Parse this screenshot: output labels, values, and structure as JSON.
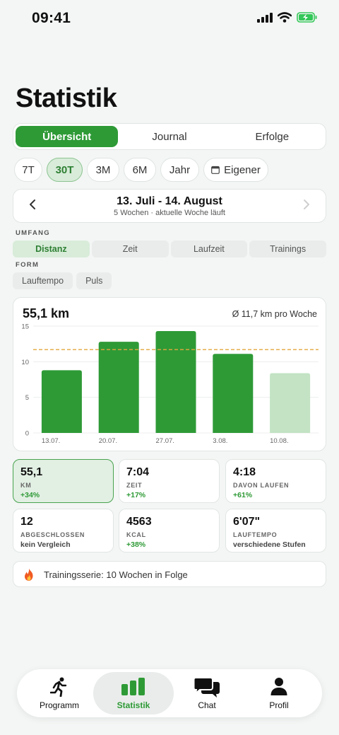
{
  "status_bar": {
    "time": "09:41"
  },
  "header": {
    "title": "Statistik"
  },
  "segments": [
    {
      "label": "Übersicht",
      "active": true
    },
    {
      "label": "Journal",
      "active": false
    },
    {
      "label": "Erfolge",
      "active": false
    }
  ],
  "ranges": [
    {
      "label": "7T",
      "active": false
    },
    {
      "label": "30T",
      "active": true
    },
    {
      "label": "3M",
      "active": false
    },
    {
      "label": "6M",
      "active": false
    },
    {
      "label": "Jahr",
      "active": false
    },
    {
      "label": "Eigener",
      "active": false,
      "icon": "calendar-icon"
    }
  ],
  "period": {
    "range": "13. Juli - 14. August",
    "subtitle": "5 Wochen · aktuelle Woche läuft"
  },
  "umfang": {
    "label": "UMFANG",
    "tabs": [
      "Distanz",
      "Zeit",
      "Laufzeit",
      "Trainings"
    ],
    "active": "Distanz"
  },
  "form": {
    "label": "FORM",
    "tabs": [
      "Lauftempo",
      "Puls"
    ]
  },
  "chart": {
    "total": "55,1 km",
    "average_label": "Ø 11,7 km pro Woche"
  },
  "chart_data": {
    "type": "bar",
    "categories": [
      "13.07.",
      "20.07.",
      "27.07.",
      "3.08.",
      "10.08."
    ],
    "values": [
      8.8,
      12.8,
      14.3,
      11.1,
      8.4
    ],
    "ylim": [
      0,
      15
    ],
    "yticks": [
      0,
      5,
      10,
      15
    ],
    "average": 11.7,
    "current_period_index": 4,
    "grid": true,
    "colors": {
      "bar": "#2e9a36",
      "current": "#c3e3c4",
      "average_line": "#e3a83c"
    }
  },
  "tiles": [
    {
      "value": "55,1",
      "label": "KM",
      "change": "+34%",
      "active": true,
      "positive": true
    },
    {
      "value": "7:04",
      "label": "ZEIT",
      "change": "+17%",
      "active": false,
      "positive": true
    },
    {
      "value": "4:18",
      "label": "DAVON LAUFEN",
      "change": "+61%",
      "active": false,
      "positive": true
    },
    {
      "value": "12",
      "label": "ABGESCHLOSSEN",
      "change": "kein Vergleich",
      "active": false,
      "positive": false
    },
    {
      "value": "4563",
      "label": "KCAL",
      "change": "+38%",
      "active": false,
      "positive": true
    },
    {
      "value": "6'07\"",
      "label": "LAUFTEMPO",
      "change": "verschiedene Stufen",
      "active": false,
      "positive": false
    }
  ],
  "streak": {
    "text": "Trainingsserie: 10 Wochen in Folge",
    "icon": "fire-icon"
  },
  "tabbar": [
    {
      "label": "Programm",
      "icon": "runner-icon",
      "active": false
    },
    {
      "label": "Statistik",
      "icon": "bar-chart-icon",
      "active": true
    },
    {
      "label": "Chat",
      "icon": "chat-icon",
      "active": false
    },
    {
      "label": "Profil",
      "icon": "person-icon",
      "active": false
    }
  ],
  "colors": {
    "accent": "#2e9a36",
    "background": "#f3f6f4"
  }
}
